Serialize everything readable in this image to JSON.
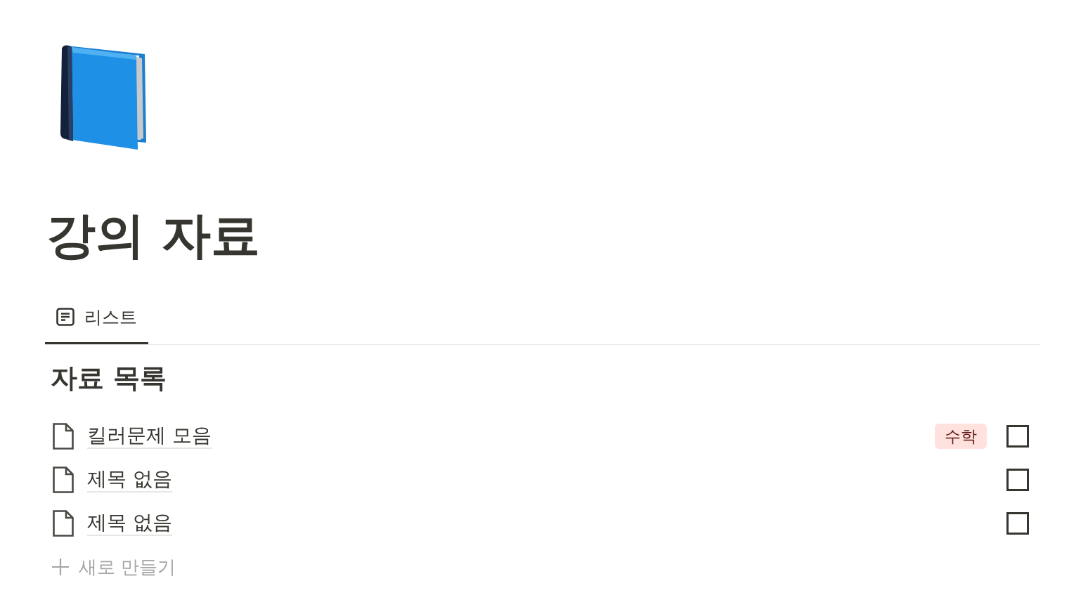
{
  "page": {
    "title": "강의 자료"
  },
  "views": [
    {
      "label": "리스트",
      "selected": true
    }
  ],
  "section": {
    "title": "자료 목록",
    "items": [
      {
        "title": "킬러문제 모음",
        "tags": [
          {
            "label": "수학",
            "color": "#ffe2dd"
          }
        ],
        "checked": false
      },
      {
        "title": "제목 없음",
        "checked": false
      },
      {
        "title": "제목 없음",
        "checked": false
      }
    ],
    "new_button": {
      "label": "새로 만들기"
    }
  }
}
